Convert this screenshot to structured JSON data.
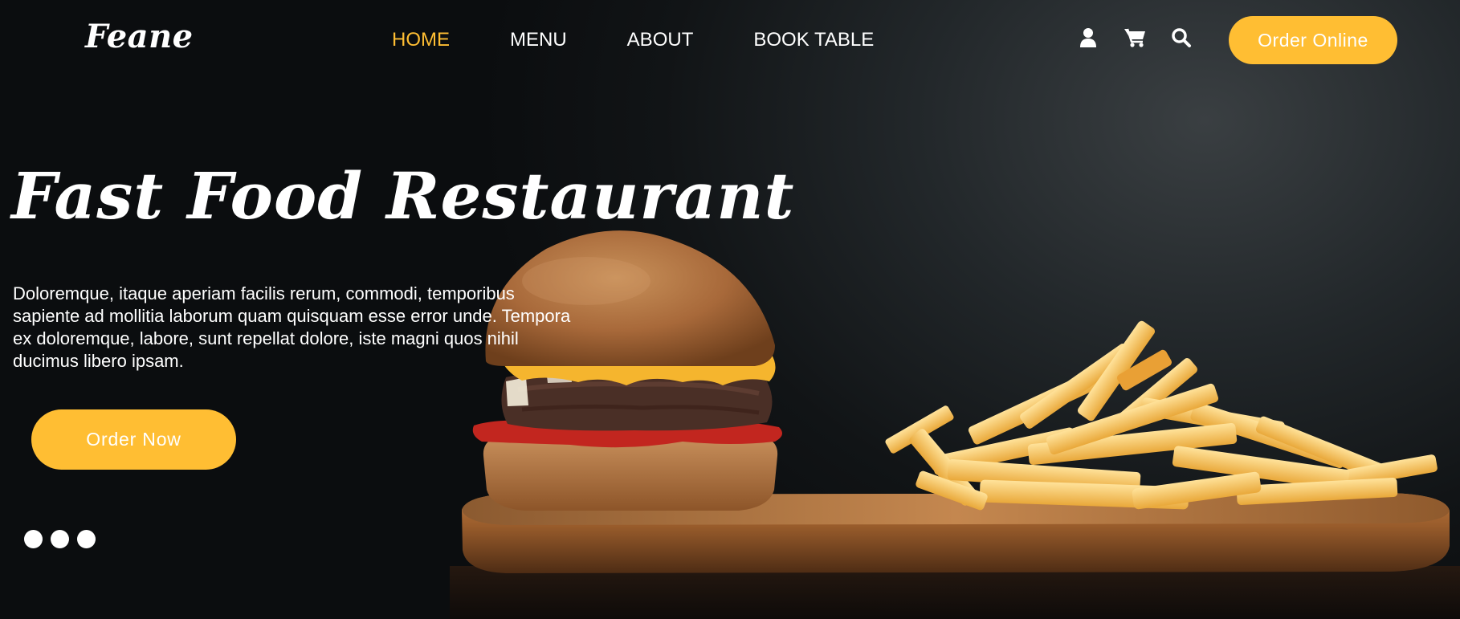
{
  "brand": {
    "name": "Feane"
  },
  "nav": {
    "items": [
      {
        "label": "HOME",
        "active": true
      },
      {
        "label": "MENU",
        "active": false
      },
      {
        "label": "ABOUT",
        "active": false
      },
      {
        "label": "BOOK TABLE",
        "active": false
      }
    ]
  },
  "header_icons": [
    "user-icon",
    "cart-icon",
    "search-icon"
  ],
  "order_online": {
    "label": "Order Online"
  },
  "hero": {
    "title": "Fast Food Restaurant",
    "description": "Doloremque, itaque aperiam facilis rerum, commodi, temporibus sapiente ad mollitia laborum quam quisquam esse error unde. Tempora ex doloremque, labore, sunt repellat dolore, iste magni quos nihil ducimus libero ipsam.",
    "cta_label": "Order Now"
  },
  "carousel": {
    "dot_count": 3
  },
  "colors": {
    "accent": "#ffbe33",
    "text": "#ffffff",
    "background": "#0c0e10"
  }
}
